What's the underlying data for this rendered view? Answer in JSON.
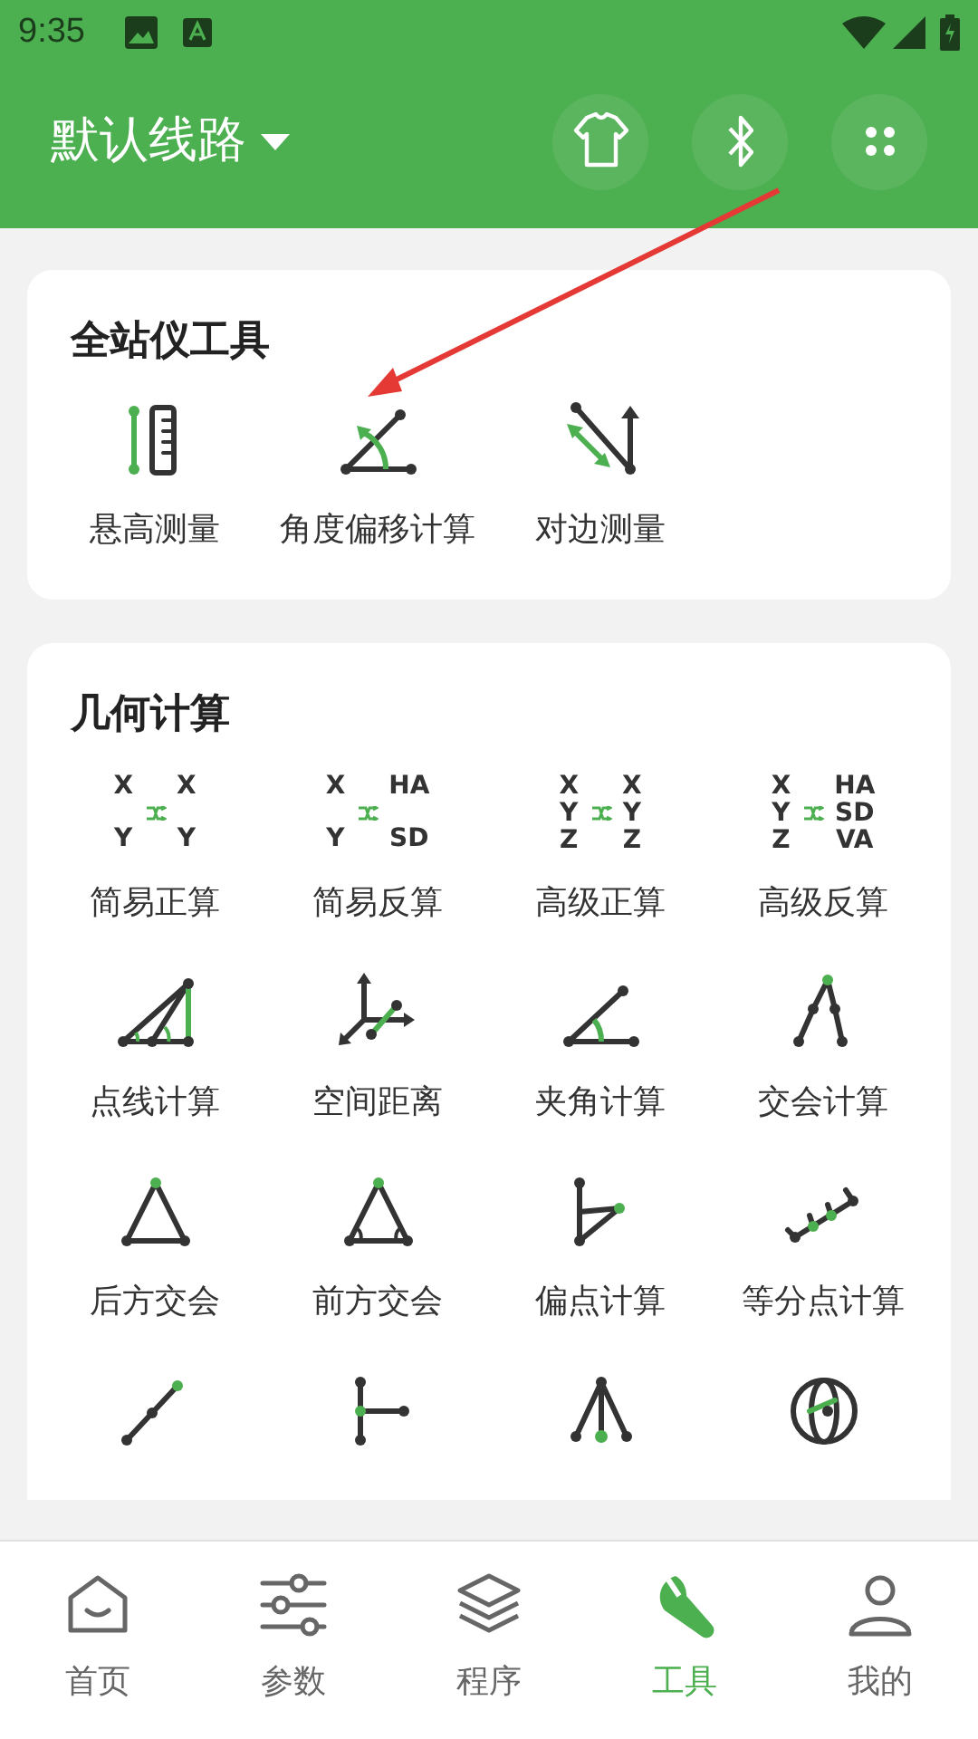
{
  "status_bar": {
    "time": "9:35"
  },
  "header": {
    "title": "默认线路"
  },
  "sections": [
    {
      "title": "全站仪工具",
      "items": [
        {
          "kind": "icon",
          "label": "悬高测量"
        },
        {
          "kind": "icon",
          "label": "角度偏移计算"
        },
        {
          "kind": "icon",
          "label": "对边测量"
        }
      ]
    },
    {
      "title": "几何计算",
      "items": [
        {
          "kind": "coords",
          "left": [
            "X",
            "Y"
          ],
          "right": [
            "X",
            "Y"
          ],
          "label": "简易正算"
        },
        {
          "kind": "coords",
          "left": [
            "X",
            "Y"
          ],
          "right": [
            "HA",
            "SD"
          ],
          "label": "简易反算"
        },
        {
          "kind": "coords",
          "left": [
            "X",
            "Y",
            "Z"
          ],
          "right": [
            "X",
            "Y",
            "Z"
          ],
          "label": "高级正算"
        },
        {
          "kind": "coords",
          "left": [
            "X",
            "Y",
            "Z"
          ],
          "right": [
            "HA",
            "SD",
            "VA"
          ],
          "label": "高级反算"
        },
        {
          "kind": "icon",
          "label": "点线计算"
        },
        {
          "kind": "icon",
          "label": "空间距离"
        },
        {
          "kind": "icon",
          "label": "夹角计算"
        },
        {
          "kind": "icon",
          "label": "交会计算"
        },
        {
          "kind": "icon",
          "label": "后方交会"
        },
        {
          "kind": "icon",
          "label": "前方交会"
        },
        {
          "kind": "icon",
          "label": "偏点计算"
        },
        {
          "kind": "icon",
          "label": "等分点计算"
        },
        {
          "kind": "icon"
        },
        {
          "kind": "icon"
        },
        {
          "kind": "icon"
        },
        {
          "kind": "icon"
        }
      ]
    }
  ],
  "bottom_nav": [
    {
      "label": "首页",
      "selected": false
    },
    {
      "label": "参数",
      "selected": false
    },
    {
      "label": "程序",
      "selected": false
    },
    {
      "label": "工具",
      "selected": true
    },
    {
      "label": "我的",
      "selected": false
    }
  ]
}
